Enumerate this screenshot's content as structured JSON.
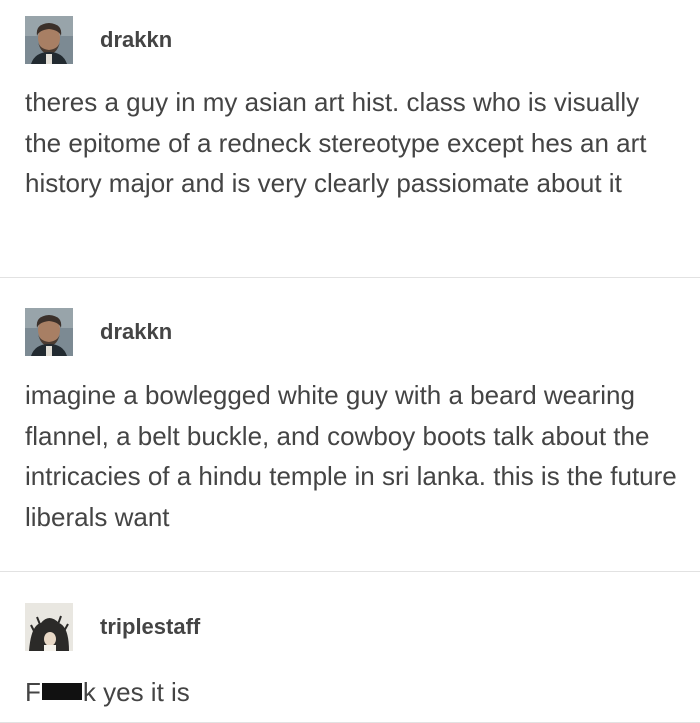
{
  "posts": [
    {
      "username": "drakkn",
      "avatar_icon": "portrait-avatar-icon",
      "text": "theres a guy in my asian art hist. class who is visually the epitome of a redneck stereotype except hes an art history major and is very clearly passiomate about it"
    },
    {
      "username": "drakkn",
      "avatar_icon": "portrait-avatar-icon",
      "text": "imagine a bowlegged white guy with a beard wearing flannel, a belt buckle, and cowboy boots talk about the intricacies of a hindu temple in sri lanka. this is the future liberals want"
    },
    {
      "username": "triplestaff",
      "avatar_icon": "photo-avatar-icon",
      "text_start": "F",
      "text_end": "k yes it is"
    }
  ],
  "colors": {
    "text": "#444444",
    "divider": "#e2e2e2",
    "background": "#ffffff"
  }
}
